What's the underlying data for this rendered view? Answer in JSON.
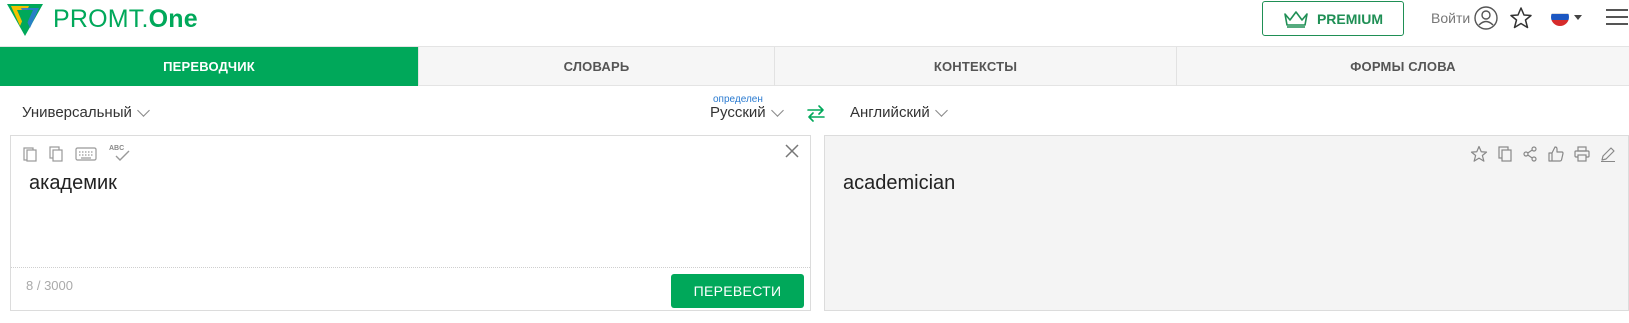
{
  "header": {
    "logo_text_main": "PROMT.",
    "logo_text_bold": "One",
    "premium_label": "PREMIUM",
    "login_label": "Войти",
    "brand_color": "#00a85a"
  },
  "tabs": [
    {
      "label": "ПЕРЕВОДЧИК",
      "active": true
    },
    {
      "label": "СЛОВАРЬ",
      "active": false
    },
    {
      "label": "КОНТЕКСТЫ",
      "active": false
    },
    {
      "label": "ФОРМЫ СЛОВА",
      "active": false
    }
  ],
  "lang_bar": {
    "topic": "Универсальный",
    "detected_label": "определен",
    "source_lang": "Русский",
    "target_lang": "Английский"
  },
  "source": {
    "text": "академик",
    "counter": "8 / 3000",
    "translate_button": "ПЕРЕВЕСТИ",
    "spellcheck_label": "ABC"
  },
  "target": {
    "text": "academician"
  },
  "icons": {
    "source_tools": [
      "paste-icon",
      "copy-icon",
      "keyboard-icon",
      "spellcheck-icon"
    ],
    "target_tools": [
      "star-icon",
      "copy-icon",
      "share-icon",
      "like-icon",
      "print-icon",
      "edit-icon"
    ]
  }
}
